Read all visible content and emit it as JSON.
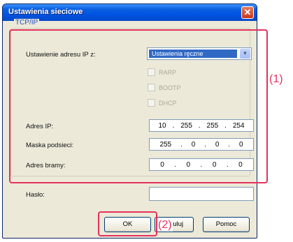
{
  "window": {
    "title": "Ustawienia sieciowe"
  },
  "group": {
    "title": "TCP/IP"
  },
  "address_source": {
    "label": "Ustawienie adresu IP z:",
    "selected": "Ustawienia ręczne",
    "options": [
      "RARP",
      "BOOTP",
      "DHCP"
    ]
  },
  "ip": {
    "label": "Adres IP:",
    "octets": [
      "10",
      "255",
      "255",
      "254"
    ]
  },
  "mask": {
    "label": "Maska podsieci:",
    "octets": [
      "255",
      "0",
      "0",
      "0"
    ]
  },
  "gateway": {
    "label": "Adres bramy:",
    "octets": [
      "0",
      "0",
      "0",
      "0"
    ]
  },
  "password": {
    "label": "Hasło:",
    "value": ""
  },
  "buttons": {
    "ok": "OK",
    "cancel": "Anuluj",
    "help": "Pomoc"
  },
  "annotations": {
    "one": "(1)",
    "two": "(2)"
  },
  "colors": {
    "annotation": "#e5305d",
    "titlebar": "#0054e3",
    "selection": "#316ac5"
  }
}
